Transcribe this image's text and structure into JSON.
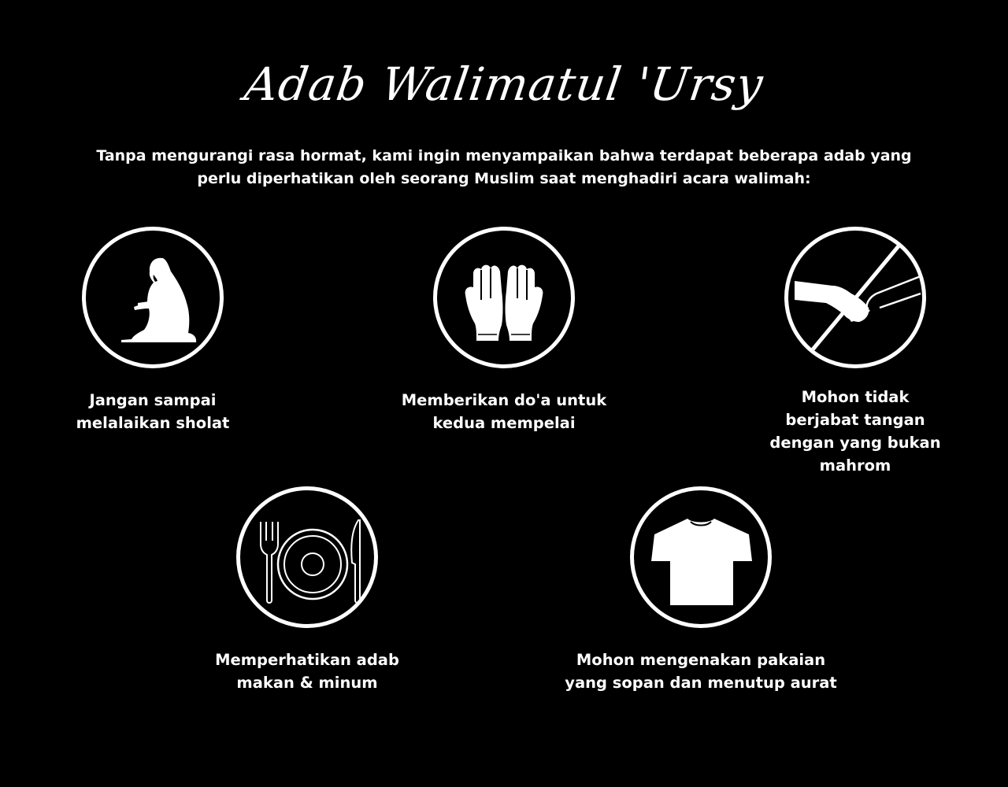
{
  "title": "Adab Walimatul 'Ursy",
  "intro": "Tanpa mengurangi rasa hormat, kami ingin menyampaikan bahwa terdapat beberapa adab yang perlu diperhatikan oleh seorang Muslim saat menghadiri acara walimah:",
  "items": [
    {
      "icon": "praying-person-icon",
      "label": "Jangan sampai melalaikan sholat"
    },
    {
      "icon": "praying-hands-icon",
      "label": "Memberikan do'a untuk kedua mempelai"
    },
    {
      "icon": "no-handshake-icon",
      "label": "Mohon tidak berjabat tangan dengan yang bukan mahrom"
    },
    {
      "icon": "plate-cutlery-icon",
      "label": "Memperhatikan adab makan & minum"
    },
    {
      "icon": "t-shirt-icon",
      "label": "Mohon mengenakan pakaian yang sopan dan menutup aurat"
    }
  ],
  "colors": {
    "background": "#000000",
    "foreground": "#ffffff"
  }
}
